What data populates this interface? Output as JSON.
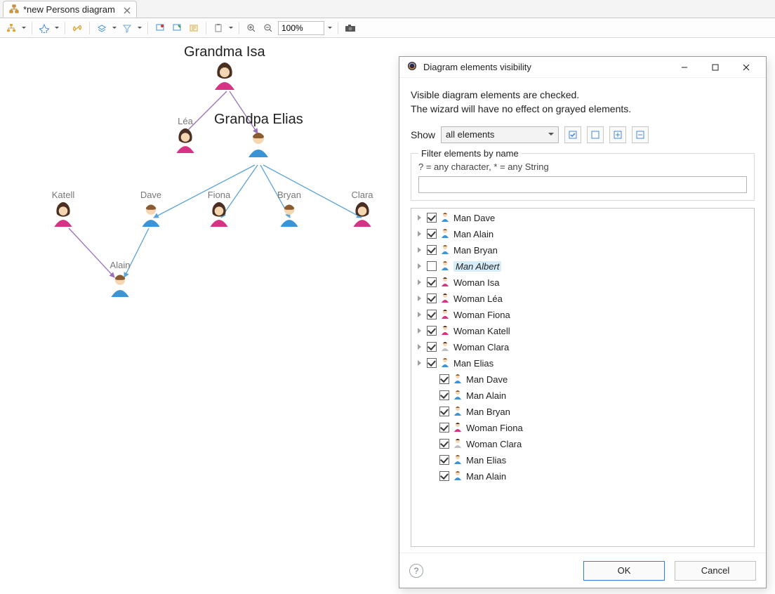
{
  "tab": {
    "title": "*new Persons diagram"
  },
  "toolbar": {
    "zoom": "100%"
  },
  "nodes": {
    "grandma": "Grandma Isa",
    "grandpa": "Grandpa Elias",
    "lea": "Léa",
    "katell": "Katell",
    "dave": "Dave",
    "fiona": "Fiona",
    "bryan": "Bryan",
    "clara": "Clara",
    "alain": "Alain"
  },
  "dialog": {
    "title": "Diagram elements visibility",
    "hint1": "Visible diagram elements are checked.",
    "hint2": "The wizard will have no effect on grayed elements.",
    "show_label": "Show",
    "show_value": "all elements",
    "filter_legend": "Filter elements by name",
    "filter_hint": "? = any character, * = any String",
    "filter_value": "",
    "ok": "OK",
    "cancel": "Cancel"
  },
  "tree": [
    {
      "expand": true,
      "checked": true,
      "type": "man",
      "label": "Man Dave"
    },
    {
      "expand": true,
      "checked": true,
      "type": "man",
      "label": "Man Alain"
    },
    {
      "expand": true,
      "checked": true,
      "type": "man",
      "label": "Man Bryan"
    },
    {
      "expand": true,
      "checked": false,
      "type": "man",
      "label": "Man Albert",
      "selected": true
    },
    {
      "expand": true,
      "checked": true,
      "type": "woman",
      "label": "Woman Isa"
    },
    {
      "expand": true,
      "checked": true,
      "type": "woman",
      "label": "Woman Léa"
    },
    {
      "expand": true,
      "checked": true,
      "type": "woman",
      "label": "Woman Fiona"
    },
    {
      "expand": true,
      "checked": true,
      "type": "woman",
      "label": "Woman Katell"
    },
    {
      "expand": true,
      "checked": true,
      "type": "woman-gray",
      "label": "Woman Clara"
    },
    {
      "expand": true,
      "checked": true,
      "type": "man",
      "label": "Man Elias"
    },
    {
      "indent": true,
      "checked": true,
      "type": "man",
      "label": "Man Dave"
    },
    {
      "indent": true,
      "checked": true,
      "type": "man",
      "label": "Man Alain"
    },
    {
      "indent": true,
      "checked": true,
      "type": "man",
      "label": "Man Bryan"
    },
    {
      "indent": true,
      "checked": true,
      "type": "woman",
      "label": "Woman Fiona"
    },
    {
      "indent": true,
      "checked": true,
      "type": "woman-gray",
      "label": "Woman Clara"
    },
    {
      "indent": true,
      "checked": true,
      "type": "man",
      "label": "Man Elias"
    },
    {
      "indent": true,
      "checked": true,
      "type": "man",
      "label": "Man Alain"
    }
  ]
}
